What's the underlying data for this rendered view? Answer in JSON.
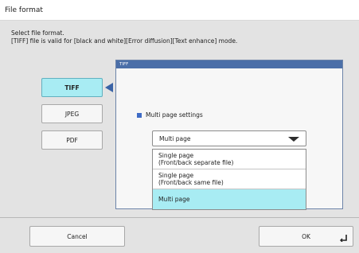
{
  "window": {
    "title": "File format"
  },
  "instructions": {
    "line1": "Select file format.",
    "line2": "[TIFF] file is valid for [black and white][Error diffusion][Text enhance] mode."
  },
  "formats": [
    {
      "label": "TIFF",
      "selected": true
    },
    {
      "label": "JPEG",
      "selected": false
    },
    {
      "label": "PDF",
      "selected": false
    }
  ],
  "tiff_panel": {
    "title": "TIFF",
    "setting_label": "Multi page settings",
    "dropdown_value": "Multi page",
    "options": [
      {
        "line1": "Single page",
        "line2": "(Front/back separate file)",
        "selected": false
      },
      {
        "line1": "Single page",
        "line2": "(Front/back same file)",
        "selected": false
      },
      {
        "line1": "Multi page",
        "line2": "",
        "selected": true
      }
    ]
  },
  "footer": {
    "cancel_label": "Cancel",
    "ok_label": "OK"
  },
  "icons": {
    "selection_pointer": "triangle-left-icon",
    "setting_marker": "square-icon",
    "dropdown_arrow": "chevron-down-icon",
    "ok_enter": "enter-return-icon"
  },
  "colors": {
    "selected_bg": "#a8ecf3",
    "panel_header": "#4b6fa8",
    "pointer": "#3a63a6",
    "marker": "#3f6cc6"
  }
}
